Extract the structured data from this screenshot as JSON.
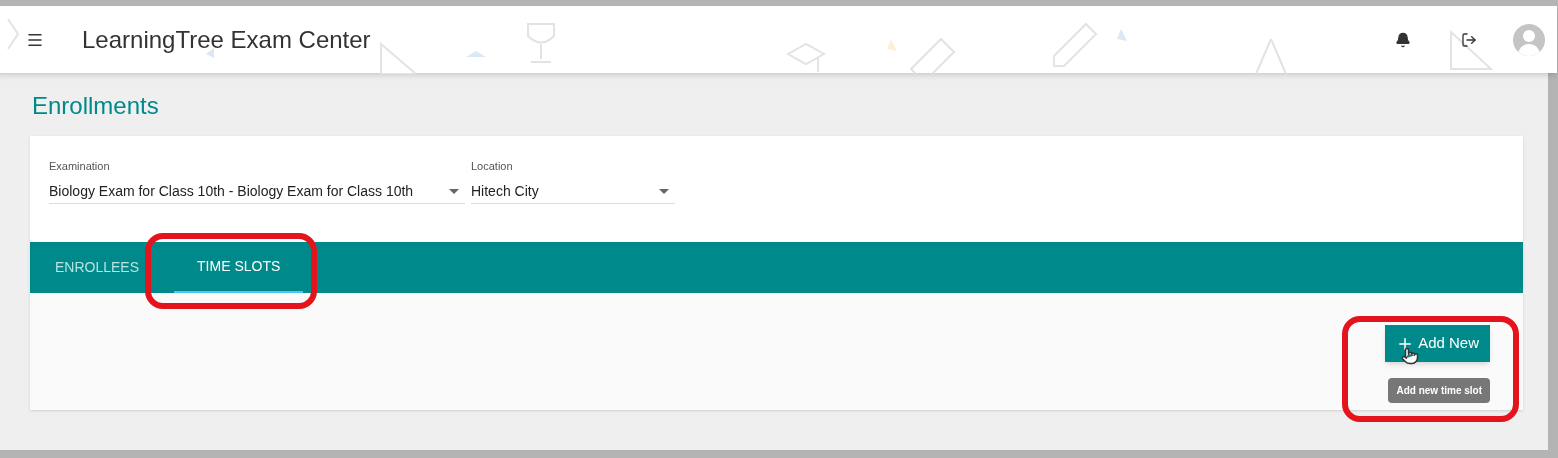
{
  "app_bar": {
    "title": "LearningTree Exam Center"
  },
  "page": {
    "title": "Enrollments"
  },
  "filters": [
    {
      "label": "Examination",
      "value": "Biology Exam for Class 10th - Biology Exam for Class 10th"
    },
    {
      "label": "Location",
      "value": "Hitech City"
    }
  ],
  "tabs": [
    {
      "label": "ENROLLEES",
      "selected": false
    },
    {
      "label": "TIME SLOTS",
      "selected": true
    }
  ],
  "add_button": {
    "label": "Add New",
    "tooltip": "Add new time slot"
  }
}
